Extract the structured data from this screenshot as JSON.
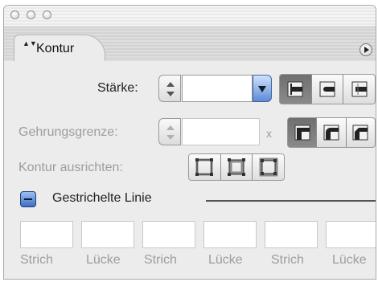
{
  "panel": {
    "tab_label": "Kontur",
    "tab_arrows": "▲▼"
  },
  "stroke": {
    "weight_label": "Stärke:",
    "weight_value": ""
  },
  "miter": {
    "label": "Gehrungsgrenze:",
    "value": "",
    "unit": "x"
  },
  "align": {
    "label": "Kontur ausrichten:"
  },
  "dashed": {
    "label": "Gestrichelte Linie",
    "fields": [
      {
        "label": "Strich",
        "value": ""
      },
      {
        "label": "Lücke",
        "value": ""
      },
      {
        "label": "Strich",
        "value": ""
      },
      {
        "label": "Lücke",
        "value": ""
      },
      {
        "label": "Strich",
        "value": ""
      },
      {
        "label": "Lücke",
        "value": ""
      }
    ]
  },
  "icons": {
    "cap": [
      "butt-cap-icon",
      "round-cap-icon",
      "projecting-cap-icon"
    ],
    "join": [
      "miter-join-icon",
      "round-join-icon",
      "bevel-join-icon"
    ],
    "align": [
      "align-center-icon",
      "align-inside-icon",
      "align-outside-icon"
    ]
  },
  "colors": {
    "accent": "#4a7bd0",
    "disabled_text": "#9d9d9d"
  }
}
